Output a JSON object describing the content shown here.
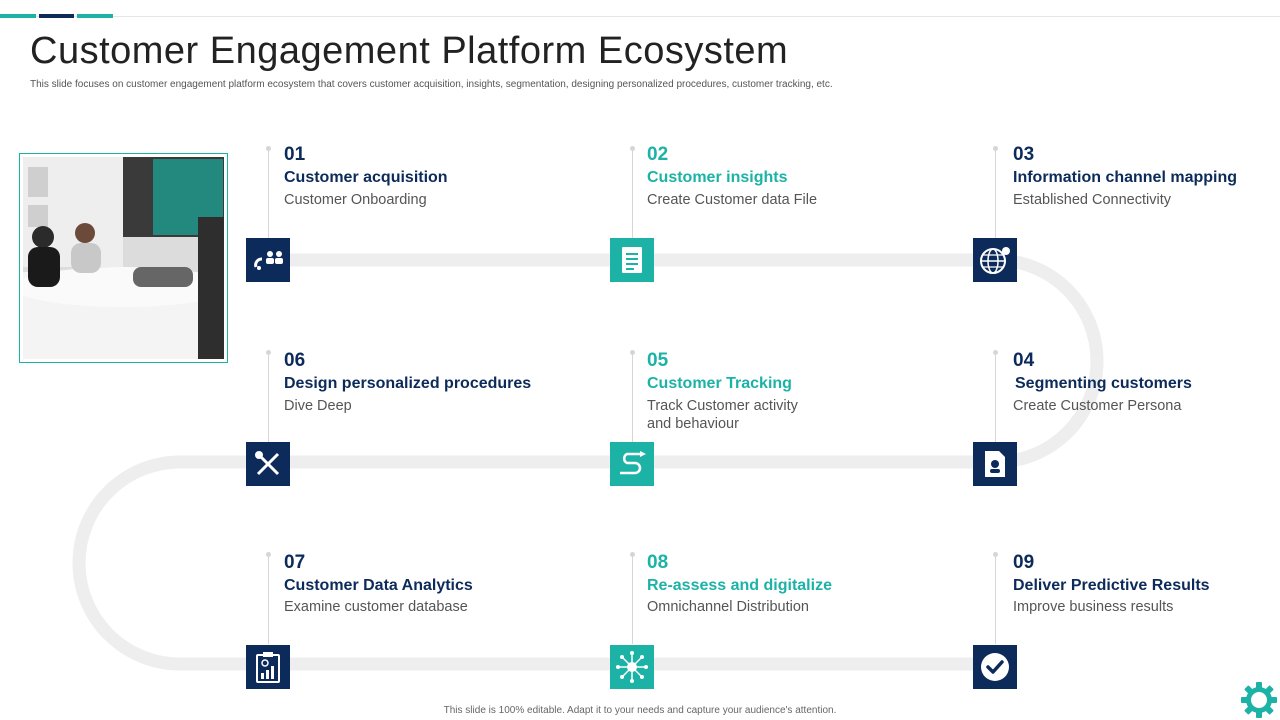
{
  "title": "Customer Engagement Platform Ecosystem",
  "subtitle": "This slide focuses on customer engagement platform ecosystem that covers customer acquisition, insights, segmentation, designing personalized procedures, customer tracking, etc.",
  "footer": "This slide is 100% editable. Adapt it to your needs and capture your audience's attention.",
  "colors": {
    "navy": "#0d2b5a",
    "teal": "#1cb3a6",
    "track": "#eeeeee"
  },
  "steps": [
    {
      "number": "01",
      "title": "Customer acquisition",
      "description": "Customer Onboarding",
      "icon": "magnet-users-icon"
    },
    {
      "number": "02",
      "title": "Customer insights",
      "description": "Create  Customer data File",
      "icon": "document-icon"
    },
    {
      "number": "03",
      "title": "Information  channel mapping",
      "description": "Established Connectivity",
      "icon": "globe-pin-icon"
    },
    {
      "number": "04",
      "title": "Segmenting customers",
      "description": "Create Customer Persona",
      "icon": "persona-file-icon"
    },
    {
      "number": "05",
      "title": "Customer Tracking",
      "description": "Track Customer activity and behaviour",
      "icon": "route-arrow-icon"
    },
    {
      "number": "06",
      "title": "Design personalized procedures",
      "description": "Dive Deep",
      "icon": "tools-icon"
    },
    {
      "number": "07",
      "title": "Customer Data Analytics",
      "description": "Examine customer database",
      "icon": "analytics-clipboard-icon"
    },
    {
      "number": "08",
      "title": "Re-assess and digitalize",
      "description": "Omnichannel Distribution",
      "icon": "network-hub-icon"
    },
    {
      "number": "09",
      "title": "Deliver Predictive Results",
      "description": "Improve business results",
      "icon": "checkmark-icon"
    }
  ]
}
